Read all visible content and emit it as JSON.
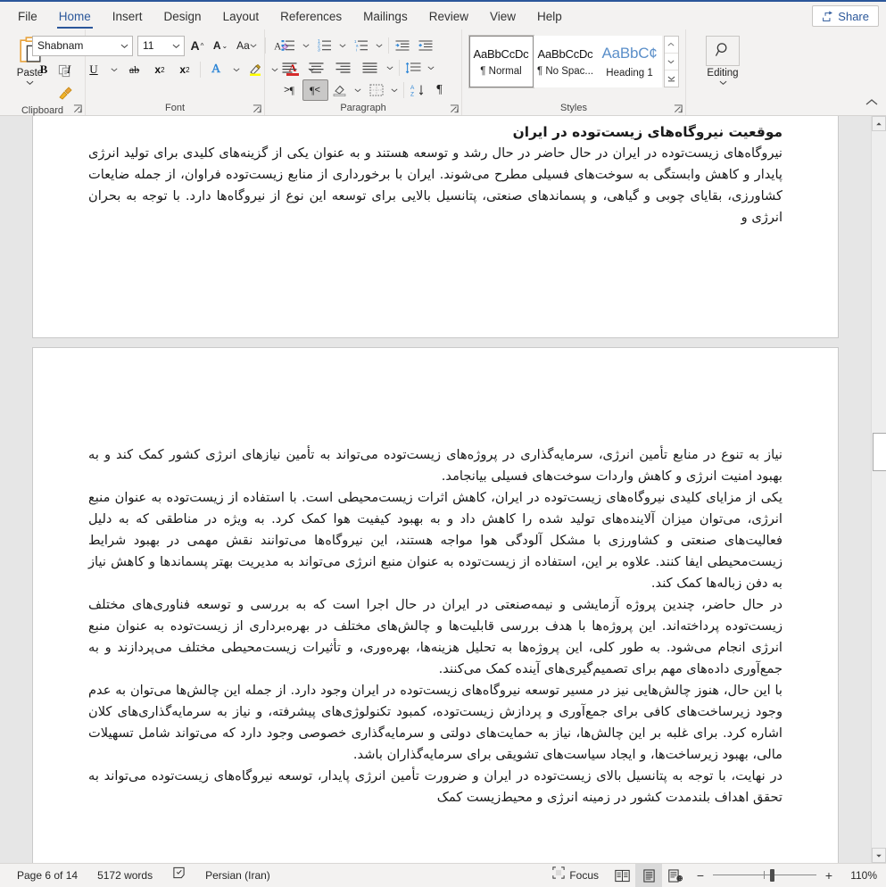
{
  "window": {
    "accent_color": "#2b579a",
    "share_label": "Share"
  },
  "tabs": [
    {
      "label": "File",
      "active": false
    },
    {
      "label": "Home",
      "active": true
    },
    {
      "label": "Insert",
      "active": false
    },
    {
      "label": "Design",
      "active": false
    },
    {
      "label": "Layout",
      "active": false
    },
    {
      "label": "References",
      "active": false
    },
    {
      "label": "Mailings",
      "active": false
    },
    {
      "label": "Review",
      "active": false
    },
    {
      "label": "View",
      "active": false
    },
    {
      "label": "Help",
      "active": false
    }
  ],
  "ribbon": {
    "clipboard": {
      "group_label": "Clipboard",
      "paste_label": "Paste",
      "cut_name": "cut",
      "copy_name": "copy",
      "format_painter_name": "format-painter"
    },
    "font": {
      "group_label": "Font",
      "font_name": "Shabnam",
      "font_size": "11",
      "grow_label": "A",
      "shrink_label": "A",
      "change_case_label": "Aa",
      "clear_formatting_label": "A",
      "bold_label": "B",
      "italic_label": "I",
      "underline_label": "U",
      "strikethrough_label": "ab",
      "subscript_label": "x",
      "subscript_sub": "2",
      "superscript_label": "x",
      "superscript_sup": "2",
      "text_effects_label": "A",
      "highlight_label": "",
      "font_color_label": "A",
      "highlight_color": "#ffff00",
      "font_color": "#d62b2b"
    },
    "paragraph": {
      "group_label": "Paragraph",
      "bullets_name": "bullet-list",
      "numbering_name": "numbered-list",
      "multilevel_name": "multilevel-list",
      "decrease_indent_name": "decrease-indent",
      "increase_indent_name": "increase-indent",
      "align_left_name": "align-left",
      "align_center_name": "align-center",
      "align_right_name": "align-right",
      "justify_name": "justify",
      "line_spacing_name": "line-spacing",
      "ltr_label": "¶",
      "rtl_label": "¶",
      "shading_name": "shading",
      "borders_name": "borders",
      "sort_label": "A Z",
      "show_marks_label": "¶"
    },
    "styles": {
      "group_label": "Styles",
      "items": [
        {
          "preview": "AaBbCcDc",
          "name": "¶ Normal",
          "selected": true,
          "heading": false
        },
        {
          "preview": "AaBbCcDc",
          "name": "¶ No Spac...",
          "selected": false,
          "heading": false
        },
        {
          "preview": "AaBbC¢",
          "name": "Heading 1",
          "selected": false,
          "heading": true
        }
      ]
    },
    "editing": {
      "group_label": "",
      "button_label": "Editing",
      "icon": "search-icon"
    }
  },
  "document": {
    "page1": {
      "heading": "موقعیت نیروگاه‌های زیست‌توده در ایران",
      "paragraph1": "نیروگاه‌های زیست‌توده در ایران در حال حاضر در حال رشد و توسعه هستند و به عنوان یکی از گزینه‌های کلیدی برای تولید انرژی پایدار و کاهش وابستگی به سوخت‌های فسیلی مطرح می‌شوند. ایران با برخورداری از منابع زیست‌توده فراوان، از جمله ضایعات کشاورزی، بقایای چوبی و گیاهی، و پسماندهای صنعتی، پتانسیل بالایی برای توسعه این نوع از نیروگاه‌ها دارد. با توجه به بحران انرژی و"
    },
    "page2": {
      "paragraph1": "نیاز به تنوع در منابع تأمین انرژی، سرمایه‌گذاری در پروژه‌های زیست‌توده می‌تواند به تأمین نیازهای انرژی کشور کمک کند و به بهبود امنیت انرژی و کاهش واردات سوخت‌های فسیلی بیانجامد.",
      "paragraph2": "یکی از مزایای کلیدی نیروگاه‌های زیست‌توده در ایران، کاهش اثرات زیست‌محیطی است. با استفاده از زیست‌توده به عنوان منبع انرژی، می‌توان میزان آلاینده‌های تولید شده را کاهش داد و به بهبود کیفیت هوا کمک کرد. به ویژه در مناطقی که به دلیل فعالیت‌های صنعتی و کشاورزی با مشکل آلودگی هوا مواجه هستند، این نیروگاه‌ها می‌توانند نقش مهمی در بهبود شرایط زیست‌محیطی ایفا کنند. علاوه بر این، استفاده از زیست‌توده به عنوان منبع انرژی می‌تواند به مدیریت بهتر پسماندها و کاهش نیاز به دفن زباله‌ها کمک کند.",
      "paragraph3": "در حال حاضر، چندین پروژه آزمایشی و نیمه‌صنعتی در ایران در حال اجرا است که به بررسی و توسعه فناوری‌های مختلف زیست‌توده پرداخته‌اند. این پروژه‌ها با هدف بررسی قابلیت‌ها و چالش‌های مختلف در بهره‌برداری از زیست‌توده به عنوان منبع انرژی انجام می‌شود. به طور کلی، این پروژه‌ها به تحلیل هزینه‌ها، بهره‌وری، و تأثیرات زیست‌محیطی مختلف می‌پردازند و به جمع‌آوری داده‌های مهم برای تصمیم‌گیری‌های آینده کمک می‌کنند.",
      "paragraph4": "با این حال، هنوز چالش‌هایی نیز در مسیر توسعه نیروگاه‌های زیست‌توده در ایران وجود دارد. از جمله این چالش‌ها می‌توان به عدم وجود زیرساخت‌های کافی برای جمع‌آوری و پردازش زیست‌توده، کمبود تکنولوژی‌های پیشرفته، و نیاز به سرمایه‌گذاری‌های کلان اشاره کرد. برای غلبه بر این چالش‌ها، نیاز به حمایت‌های دولتی و سرمایه‌گذاری خصوصی وجود دارد که می‌تواند شامل تسهیلات مالی، بهبود زیرساخت‌ها، و ایجاد سیاست‌های تشویقی برای سرمایه‌گذاران باشد.",
      "paragraph5": "در نهایت، با توجه به پتانسیل بالای زیست‌توده در ایران و ضرورت تأمین انرژی پایدار، توسعه نیروگاه‌های زیست‌توده می‌تواند به تحقق اهداف بلندمدت کشور در زمینه انرژی و محیط‌زیست کمک"
    }
  },
  "status": {
    "page_indicator": "Page 6 of 14",
    "word_count": "5172 words",
    "proofing_icon": "proofing-icon",
    "language": "Persian (Iran)",
    "focus_label": "Focus",
    "view_read_name": "read-mode-icon",
    "view_print_name": "print-layout-icon",
    "view_web_name": "web-layout-icon",
    "zoom_out": "−",
    "zoom_in": "+",
    "zoom_level": "110%"
  }
}
